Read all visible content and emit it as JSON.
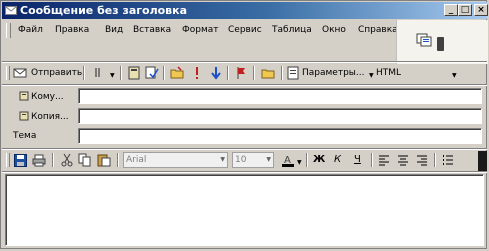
{
  "window": {
    "title": "Сообщение без заголовка"
  },
  "window_buttons": {
    "minimize": "_",
    "maximize": "□",
    "close": "×"
  },
  "menu": [
    "Файл",
    "Правка",
    "Вид",
    "Вставка",
    "Формат",
    "Сервис",
    "Таблица",
    "Окно",
    "Справка"
  ],
  "toolbar": {
    "send_label": "Отправить",
    "params_label": "Параметры...",
    "format_label": "HTML"
  },
  "fields": {
    "to_label": "Кому...",
    "cc_label": "Копия...",
    "subject_label": "Тема",
    "to_value": "",
    "cc_value": "",
    "subject_value": ""
  },
  "format_bar": {
    "font_name": "Arial",
    "font_size": "10",
    "bold": "Ж",
    "italic": "К",
    "underline": "Ч"
  },
  "icons": {
    "font_color_letter": "A"
  }
}
